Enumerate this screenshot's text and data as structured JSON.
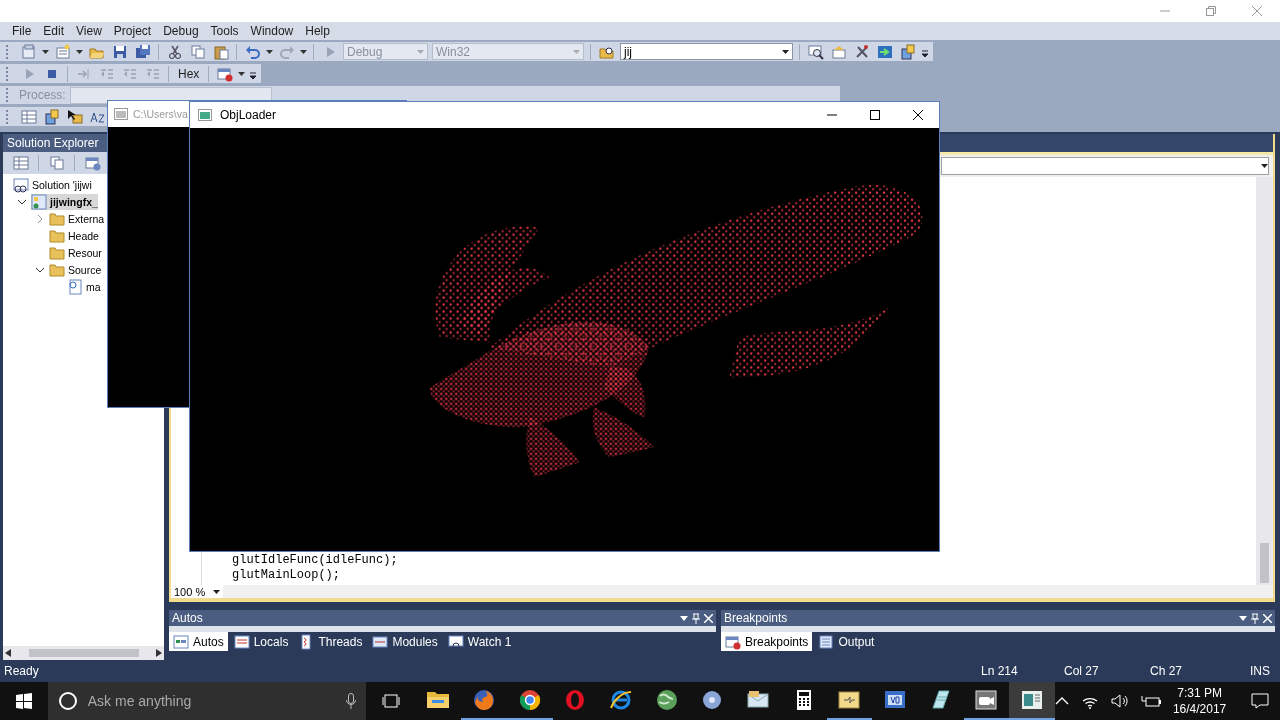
{
  "ide_window": {
    "menu": [
      "File",
      "Edit",
      "View",
      "Project",
      "Debug",
      "Tools",
      "Window",
      "Help"
    ],
    "toolbar": {
      "configuration": "Debug",
      "platform": "Win32",
      "find_box": "jij",
      "hex_button": "Hex",
      "process_label": "Process:"
    },
    "solution_explorer": {
      "title": "Solution Explorer",
      "tree": [
        {
          "label": "Solution 'jijwi",
          "selected": false,
          "children": [
            {
              "label": "jijwingfx_",
              "selected": true,
              "expanded": true,
              "children": [
                {
                  "label": "Externa",
                  "selected": false,
                  "expanded": false
                },
                {
                  "label": "Heade",
                  "selected": false
                },
                {
                  "label": "Resour",
                  "selected": false
                },
                {
                  "label": "Source",
                  "selected": false,
                  "expanded": true,
                  "children": [
                    {
                      "label": "ma",
                      "selected": false
                    }
                  ]
                }
              ]
            }
          ]
        }
      ]
    },
    "editor": {
      "code_lines": [
        "glutIdleFunc(idleFunc);",
        "glutMainLoop();"
      ],
      "zoom": "100 %"
    },
    "autos_panel": {
      "title": "Autos",
      "tabs": [
        {
          "label": "Autos",
          "selected": true
        },
        {
          "label": "Locals",
          "selected": false
        },
        {
          "label": "Threads",
          "selected": false
        },
        {
          "label": "Modules",
          "selected": false
        },
        {
          "label": "Watch 1",
          "selected": false
        }
      ]
    },
    "breakpoints_panel": {
      "title": "Breakpoints",
      "tabs": [
        {
          "label": "Breakpoints",
          "selected": true
        },
        {
          "label": "Output",
          "selected": false
        }
      ]
    },
    "status_bar": {
      "message": "Ready",
      "line": "Ln 214",
      "column": "Col 27",
      "char": "Ch 27",
      "mode": "INS"
    }
  },
  "console_window": {
    "title": "C:\\Users\\va"
  },
  "objloader_window": {
    "title": "ObjLoader"
  },
  "taskbar": {
    "search": {
      "placeholder": "Ask me anything"
    },
    "apps": [
      {
        "kind": "folder",
        "running": false,
        "selected": false
      },
      {
        "kind": "firefox",
        "running": true,
        "selected": false
      },
      {
        "kind": "chrome",
        "running": true,
        "selected": false
      },
      {
        "kind": "opera",
        "running": false,
        "selected": false
      },
      {
        "kind": "ie",
        "running": false,
        "selected": false
      },
      {
        "kind": "globe",
        "running": false,
        "selected": false
      },
      {
        "kind": "disc",
        "running": false,
        "selected": false
      },
      {
        "kind": "mail",
        "running": false,
        "selected": false
      },
      {
        "kind": "calculator",
        "running": false,
        "selected": false
      },
      {
        "kind": "package",
        "running": true,
        "selected": false
      },
      {
        "kind": "vb",
        "running": false,
        "selected": false
      },
      {
        "kind": "notepad",
        "running": false,
        "selected": false
      },
      {
        "kind": "video",
        "running": true,
        "selected": false
      },
      {
        "kind": "window",
        "running": true,
        "selected": true
      }
    ],
    "clock": {
      "time": "7:31 PM",
      "date": "16/4/2017"
    }
  }
}
